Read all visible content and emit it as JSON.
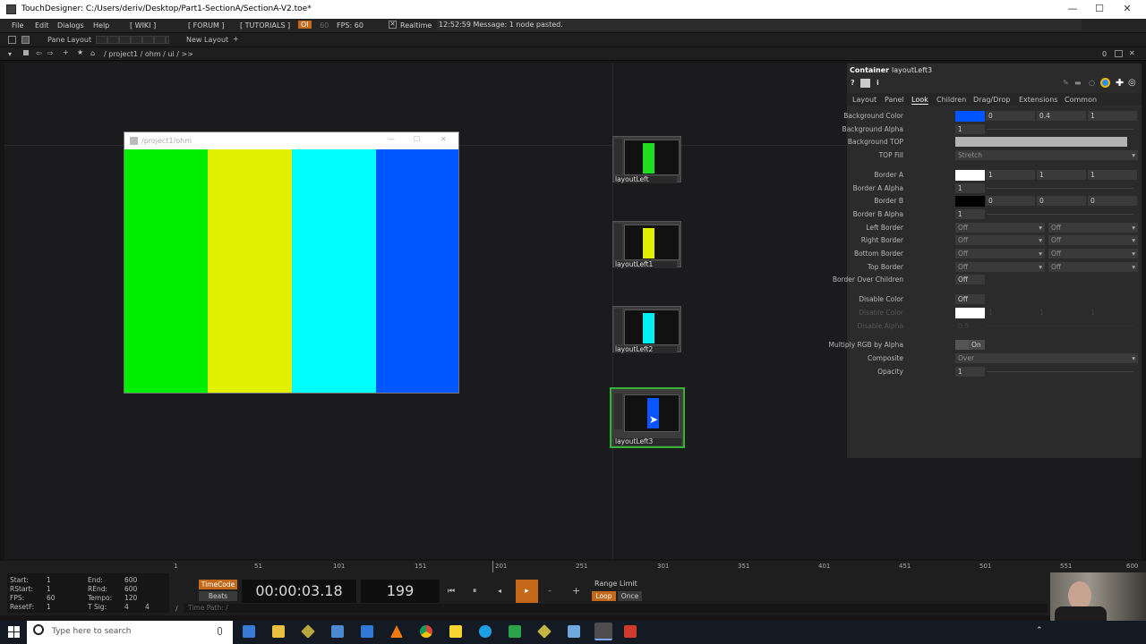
{
  "window": {
    "title": "TouchDesigner: C:/Users/deriv/Desktop/Part1-SectionA/SectionA-V2.toe*",
    "minimize": "—",
    "maximize": "☐",
    "close": "✕"
  },
  "menu": {
    "items": [
      "File",
      "Edit",
      "Dialogs",
      "Help"
    ],
    "wiki": "[ WIKI ]",
    "forum": "[ FORUM ]",
    "tutorials": "[ TUTORIALS ]",
    "oi": "OI",
    "fps_num": "60",
    "fps": "FPS: 60",
    "realtime": "Realtime",
    "message": "12:52:59 Message: 1 node pasted."
  },
  "panebar": {
    "pane_layout": "Pane Layout",
    "new_layout": "New Layout",
    "plus": "+"
  },
  "path": {
    "text": "/ project1 / ohm / ui / >>",
    "p1": "0"
  },
  "viewer": {
    "title": "/project1/ohm",
    "colors": [
      "#00ee00",
      "#e2ef00",
      "#00ffff",
      "#0057ff"
    ]
  },
  "nodes": [
    {
      "label": "layoutLeft",
      "color": "#1fdd1f"
    },
    {
      "label": "layoutLeft1",
      "color": "#e3ef00"
    },
    {
      "label": "layoutLeft2",
      "color": "#00f0f0"
    },
    {
      "label": "layoutLeft3",
      "color": "#0a55ff"
    }
  ],
  "params": {
    "op_type": "Container",
    "op_name": "layoutLeft3",
    "tabs": [
      "Layout",
      "Panel",
      "Look",
      "Children",
      "Drag/Drop",
      "Extensions",
      "Common"
    ],
    "active_tab": "Look",
    "rows": {
      "bg_color": {
        "label": "Background Color",
        "v1": "0",
        "v2": "0.4",
        "v3": "1",
        "swatch": "#0055ff"
      },
      "bg_alpha": {
        "label": "Background Alpha",
        "v": "1"
      },
      "bg_top": {
        "label": "Background TOP"
      },
      "top_fill": {
        "label": "TOP Fill",
        "v": "Stretch"
      },
      "border_a": {
        "label": "Border A",
        "v1": "1",
        "v2": "1",
        "v3": "1",
        "swatch": "#ffffff"
      },
      "border_a_alpha": {
        "label": "Border A Alpha",
        "v": "1"
      },
      "border_b": {
        "label": "Border B",
        "v1": "0",
        "v2": "0",
        "v3": "0",
        "swatch": "#000000"
      },
      "border_b_alpha": {
        "label": "Border B Alpha",
        "v": "1"
      },
      "left_border": {
        "label": "Left Border",
        "v1": "Off",
        "v2": "Off"
      },
      "right_border": {
        "label": "Right Border",
        "v1": "Off",
        "v2": "Off"
      },
      "bottom_border": {
        "label": "Bottom Border",
        "v1": "Off",
        "v2": "Off"
      },
      "top_border": {
        "label": "Top Border",
        "v1": "Off",
        "v2": "Off"
      },
      "border_over": {
        "label": "Border Over Children",
        "v": "Off"
      },
      "disable_color_toggle": {
        "label": "Disable Color",
        "v": "Off"
      },
      "disable_color": {
        "label": "Disable Color",
        "v1": "1",
        "v2": "1",
        "v3": "1",
        "swatch": "#ffffff"
      },
      "disable_alpha": {
        "label": "Disable Alpha",
        "v": "0.5"
      },
      "multiply": {
        "label": "Multiply RGB by Alpha",
        "v": "On"
      },
      "composite": {
        "label": "Composite",
        "v": "Over"
      },
      "opacity": {
        "label": "Opacity",
        "v": "1"
      }
    }
  },
  "timeline": {
    "ticks": [
      "1",
      "51",
      "101",
      "151",
      "201",
      "251",
      "301",
      "351",
      "401",
      "451",
      "501",
      "551",
      "600"
    ]
  },
  "transport": {
    "start_l": "Start:",
    "start": "1",
    "end_l": "End:",
    "end": "600",
    "rstart_l": "RStart:",
    "rstart": "1",
    "rend_l": "REnd:",
    "rend": "600",
    "fps_l": "FPS:",
    "fps": "60",
    "tempo_l": "Tempo:",
    "tempo": "120",
    "resetf_l": "ResetF:",
    "resetf": "1",
    "tsig_l": "T Sig:",
    "tsig1": "4",
    "tsig2": "4",
    "timecode": "TimeCode",
    "beats": "Beats",
    "time": "00:00:03.18",
    "frame": "199",
    "range_limit": "Range Limit",
    "loop": "Loop",
    "once": "Once",
    "time_path": "Time Path: /",
    "slash": "/"
  },
  "taskbar": {
    "search_placeholder": "Type here to search"
  }
}
